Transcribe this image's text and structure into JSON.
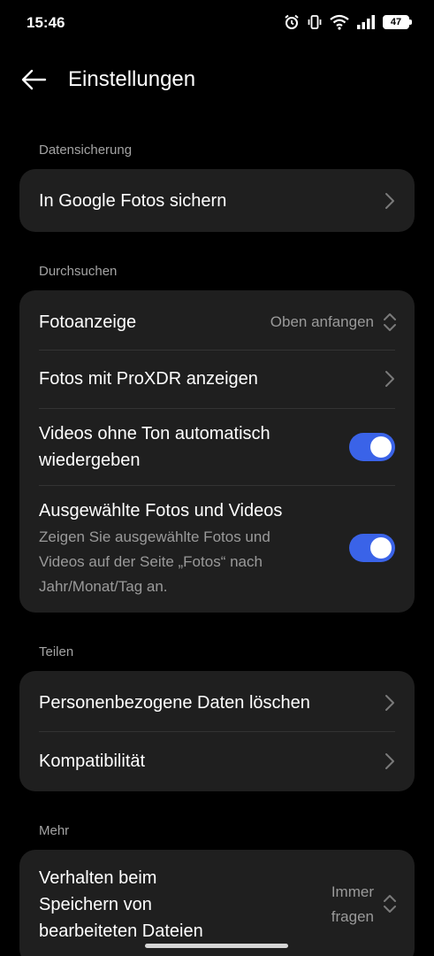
{
  "statusbar": {
    "time": "15:46",
    "battery_level": "47",
    "icons": [
      "alarm-icon",
      "vibrate-icon",
      "wifi-icon",
      "signal-icon",
      "battery-icon"
    ]
  },
  "header": {
    "back_icon": "arrow-left-icon",
    "title": "Einstellungen"
  },
  "sections": {
    "backup": {
      "label": "Datensicherung",
      "items": [
        {
          "title": "In Google Fotos sichern"
        }
      ]
    },
    "browse": {
      "label": "Durchsuchen",
      "items": [
        {
          "title": "Fotoanzeige",
          "value": "Oben anfangen"
        },
        {
          "title": "Fotos mit ProXDR anzeigen"
        },
        {
          "title_line1": "Videos ohne Ton automatisch",
          "title_line2": "wiedergeben",
          "toggle_on": true
        },
        {
          "title": "Ausgewählte Fotos und Videos",
          "sub_line1": "Zeigen Sie ausgewählte Fotos und",
          "sub_line2": "Videos auf der Seite „Fotos“ nach",
          "sub_line3": "Jahr/Monat/Tag an.",
          "toggle_on": true
        }
      ]
    },
    "share": {
      "label": "Teilen",
      "items": [
        {
          "title": "Personenbezogene Daten löschen"
        },
        {
          "title": "Kompatibilität"
        }
      ]
    },
    "more": {
      "label": "Mehr",
      "items": [
        {
          "title_line1": "Verhalten beim",
          "title_line2": "Speichern von",
          "title_line3": "bearbeiteten Dateien",
          "value_line1": "Immer",
          "value_line2": "fragen"
        }
      ]
    }
  },
  "colors": {
    "background": "#000000",
    "card": "#1f1f1f",
    "accent": "#3a63e8",
    "secondary_text": "#9a9a9a"
  }
}
